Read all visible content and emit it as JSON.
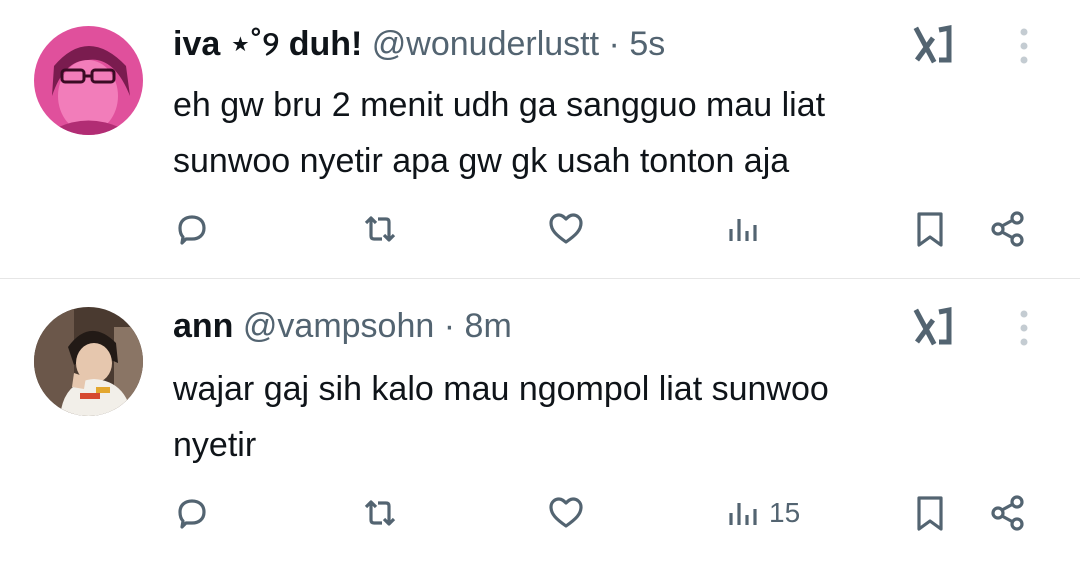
{
  "tweets": [
    {
      "author_name": "iva ⋆˚୨ duh!",
      "handle": "@wonuderlustt",
      "separator": "·",
      "time": "5s",
      "text": "eh gw bru 2 menit udh ga sangguo mau liat\nsunwoo nyetir apa gw gk usah tonton aja",
      "views": ""
    },
    {
      "author_name": "ann",
      "handle": "@vampsohn",
      "separator": "·",
      "time": "8m",
      "text": "wajar gaj sih kalo mau ngompol liat sunwoo\nnyetir",
      "views": "15"
    }
  ],
  "icons": {
    "reply": "reply-icon",
    "repost": "repost-icon",
    "like": "heart-icon",
    "views": "views-icon",
    "bookmark": "bookmark-icon",
    "share": "share-icon",
    "grok": "grok-icon",
    "more": "more-icon"
  },
  "colors": {
    "text": "#0f1419",
    "secondary": "#536471",
    "divider": "#e6e6e6",
    "avatar1": "#e0509c"
  }
}
